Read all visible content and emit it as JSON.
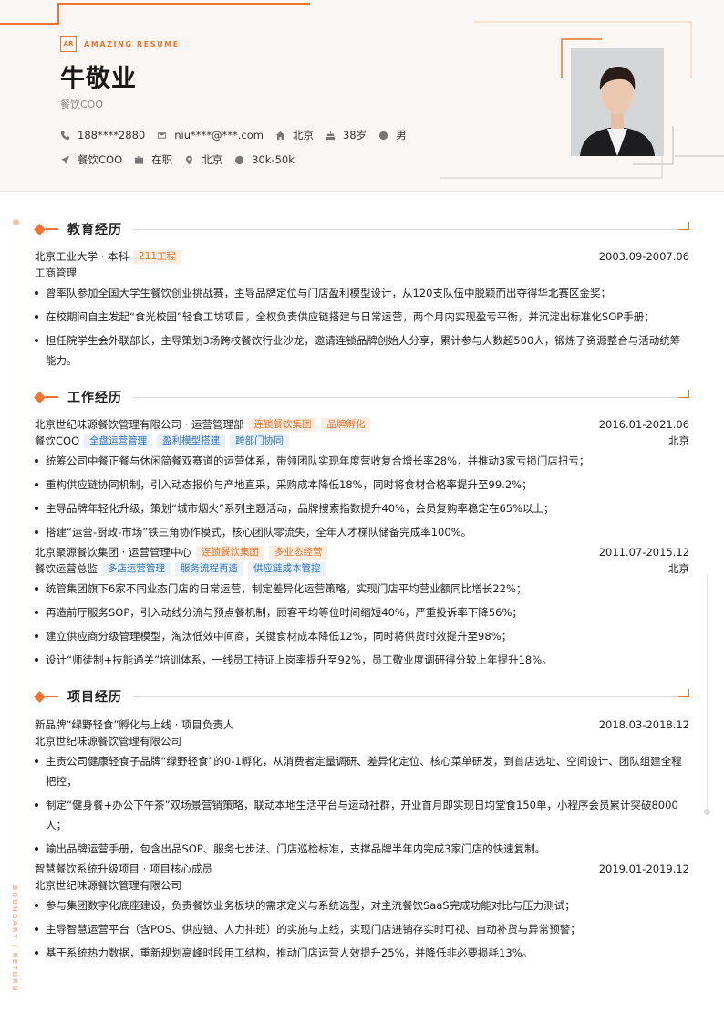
{
  "header": {
    "brand_mark": "AR",
    "brand_text": "AMAZING RESUME",
    "name": "牛敬业",
    "role": "餐饮COO",
    "row1": [
      {
        "icon": "phone-icon",
        "text": "188****2880"
      },
      {
        "icon": "mail-icon",
        "text": "niu****@***.com"
      },
      {
        "icon": "home-icon",
        "text": "北京"
      },
      {
        "icon": "cake-icon",
        "text": "38岁"
      },
      {
        "icon": "gender-icon",
        "text": "男"
      }
    ],
    "row2": [
      {
        "icon": "send-icon",
        "text": "餐饮COO"
      },
      {
        "icon": "briefcase-icon",
        "text": "在职"
      },
      {
        "icon": "location-pin-icon",
        "text": "北京"
      },
      {
        "icon": "salary-icon",
        "text": "30k-50k"
      }
    ]
  },
  "side_text": "BOUNDARY / RETURN",
  "sections": {
    "education": {
      "title": "教育经历",
      "items": [
        {
          "school": "北京工业大学 · 本科",
          "tag": "211工程",
          "date": "2003.09-2007.06",
          "major": "工商管理",
          "bullets": [
            "曾率队参加全国大学生餐饮创业挑战赛，主导品牌定位与门店盈利模型设计，从120支队伍中脱颖而出夺得华北赛区金奖；",
            "在校期间自主发起“食光校园”轻食工坊项目，全权负责供应链搭建与日常运营，两个月内实现盈亏平衡，并沉淀出标准化SOP手册；",
            "担任院学生会外联部长，主导策划3场跨校餐饮行业沙龙，邀请连锁品牌创始人分享，累计参与人数超500人，锻炼了资源整合与活动统筹能力。"
          ]
        }
      ]
    },
    "work": {
      "title": "工作经历",
      "items": [
        {
          "company": "北京世纪味源餐饮管理有限公司 · 运营管理部",
          "tags": [
            "连锁餐饮集团",
            "品牌孵化"
          ],
          "date": "2016.01-2021.06",
          "position": "餐饮COO",
          "skills": [
            "全盘运营管理",
            "盈利模型搭建",
            "跨部门协同"
          ],
          "location": "北京",
          "bullets": [
            "统筹公司中餐正餐与休闲简餐双赛道的运营体系，带领团队实现年度营收复合增长率28%，并推动3家亏损门店扭亏；",
            "重构供应链协同机制，引入动态报价与产地直采，采购成本降低18%，同时将食材合格率提升至99.2%；",
            "主导品牌年轻化升级，策划“城市烟火”系列主题活动，品牌搜索指数提升40%，会员复购率稳定在65%以上；",
            "搭建“运营-厨政-市场”铁三角协作模式，核心团队零流失，全年人才梯队储备完成率100%。"
          ]
        },
        {
          "company": "北京聚源餐饮集团 · 运营管理中心",
          "tags": [
            "连锁餐饮集团",
            "多业态经营"
          ],
          "date": "2011.07-2015.12",
          "position": "餐饮运营总监",
          "skills": [
            "多店运营管理",
            "服务流程再造",
            "供应链成本管控"
          ],
          "location": "北京",
          "bullets": [
            "统管集团旗下6家不同业态门店的日常运营，制定差异化运营策略，实现门店平均营业额同比增长22%；",
            "再造前厅服务SOP，引入动线分流与预点餐机制，顾客平均等位时间缩短40%，严重投诉率下降56%；",
            "建立供应商分级管理模型，淘汰低效中间商，关键食材成本降低12%，同时将供货时效提升至98%；",
            "设计“师徒制+技能通关”培训体系，一线员工持证上岗率提升至92%，员工敬业度调研得分较上年提升18%。"
          ]
        }
      ]
    },
    "projects": {
      "title": "项目经历",
      "items": [
        {
          "name": "新品牌“绿野轻食”孵化与上线 · 项目负责人",
          "date": "2018.03-2018.12",
          "org": "北京世纪味源餐饮管理有限公司",
          "bullets": [
            "主责公司健康轻食子品牌“绿野轻食”的0-1孵化，从消费者定量调研、差异化定位、核心菜单研发，到首店选址、空间设计、团队组建全程把控；",
            "制定“健身餐+办公下午茶”双场景营销策略，联动本地生活平台与运动社群，开业首月即实现日均堂食150单，小程序会员累计突破8000人；",
            "输出品牌运营手册，包含出品SOP、服务七步法、门店巡检标准，支撑品牌半年内完成3家门店的快速复制。"
          ]
        },
        {
          "name": "智慧餐饮系统升级项目 · 项目核心成员",
          "date": "2019.01-2019.12",
          "org": "北京世纪味源餐饮管理有限公司",
          "bullets": [
            "参与集团数字化底座建设，负责餐饮业务板块的需求定义与系统选型，对主流餐饮SaaS完成功能对比与压力测试；",
            "主导智慧运营平台（含POS、供应链、人力排班）的实施与上线，实现门店进销存实时可视、自动补货与异常预警；",
            "基于系统热力数据，重新规划高峰时段用工结构，推动门店运营人效提升25%，并降低非必要损耗13%。"
          ]
        }
      ]
    }
  }
}
